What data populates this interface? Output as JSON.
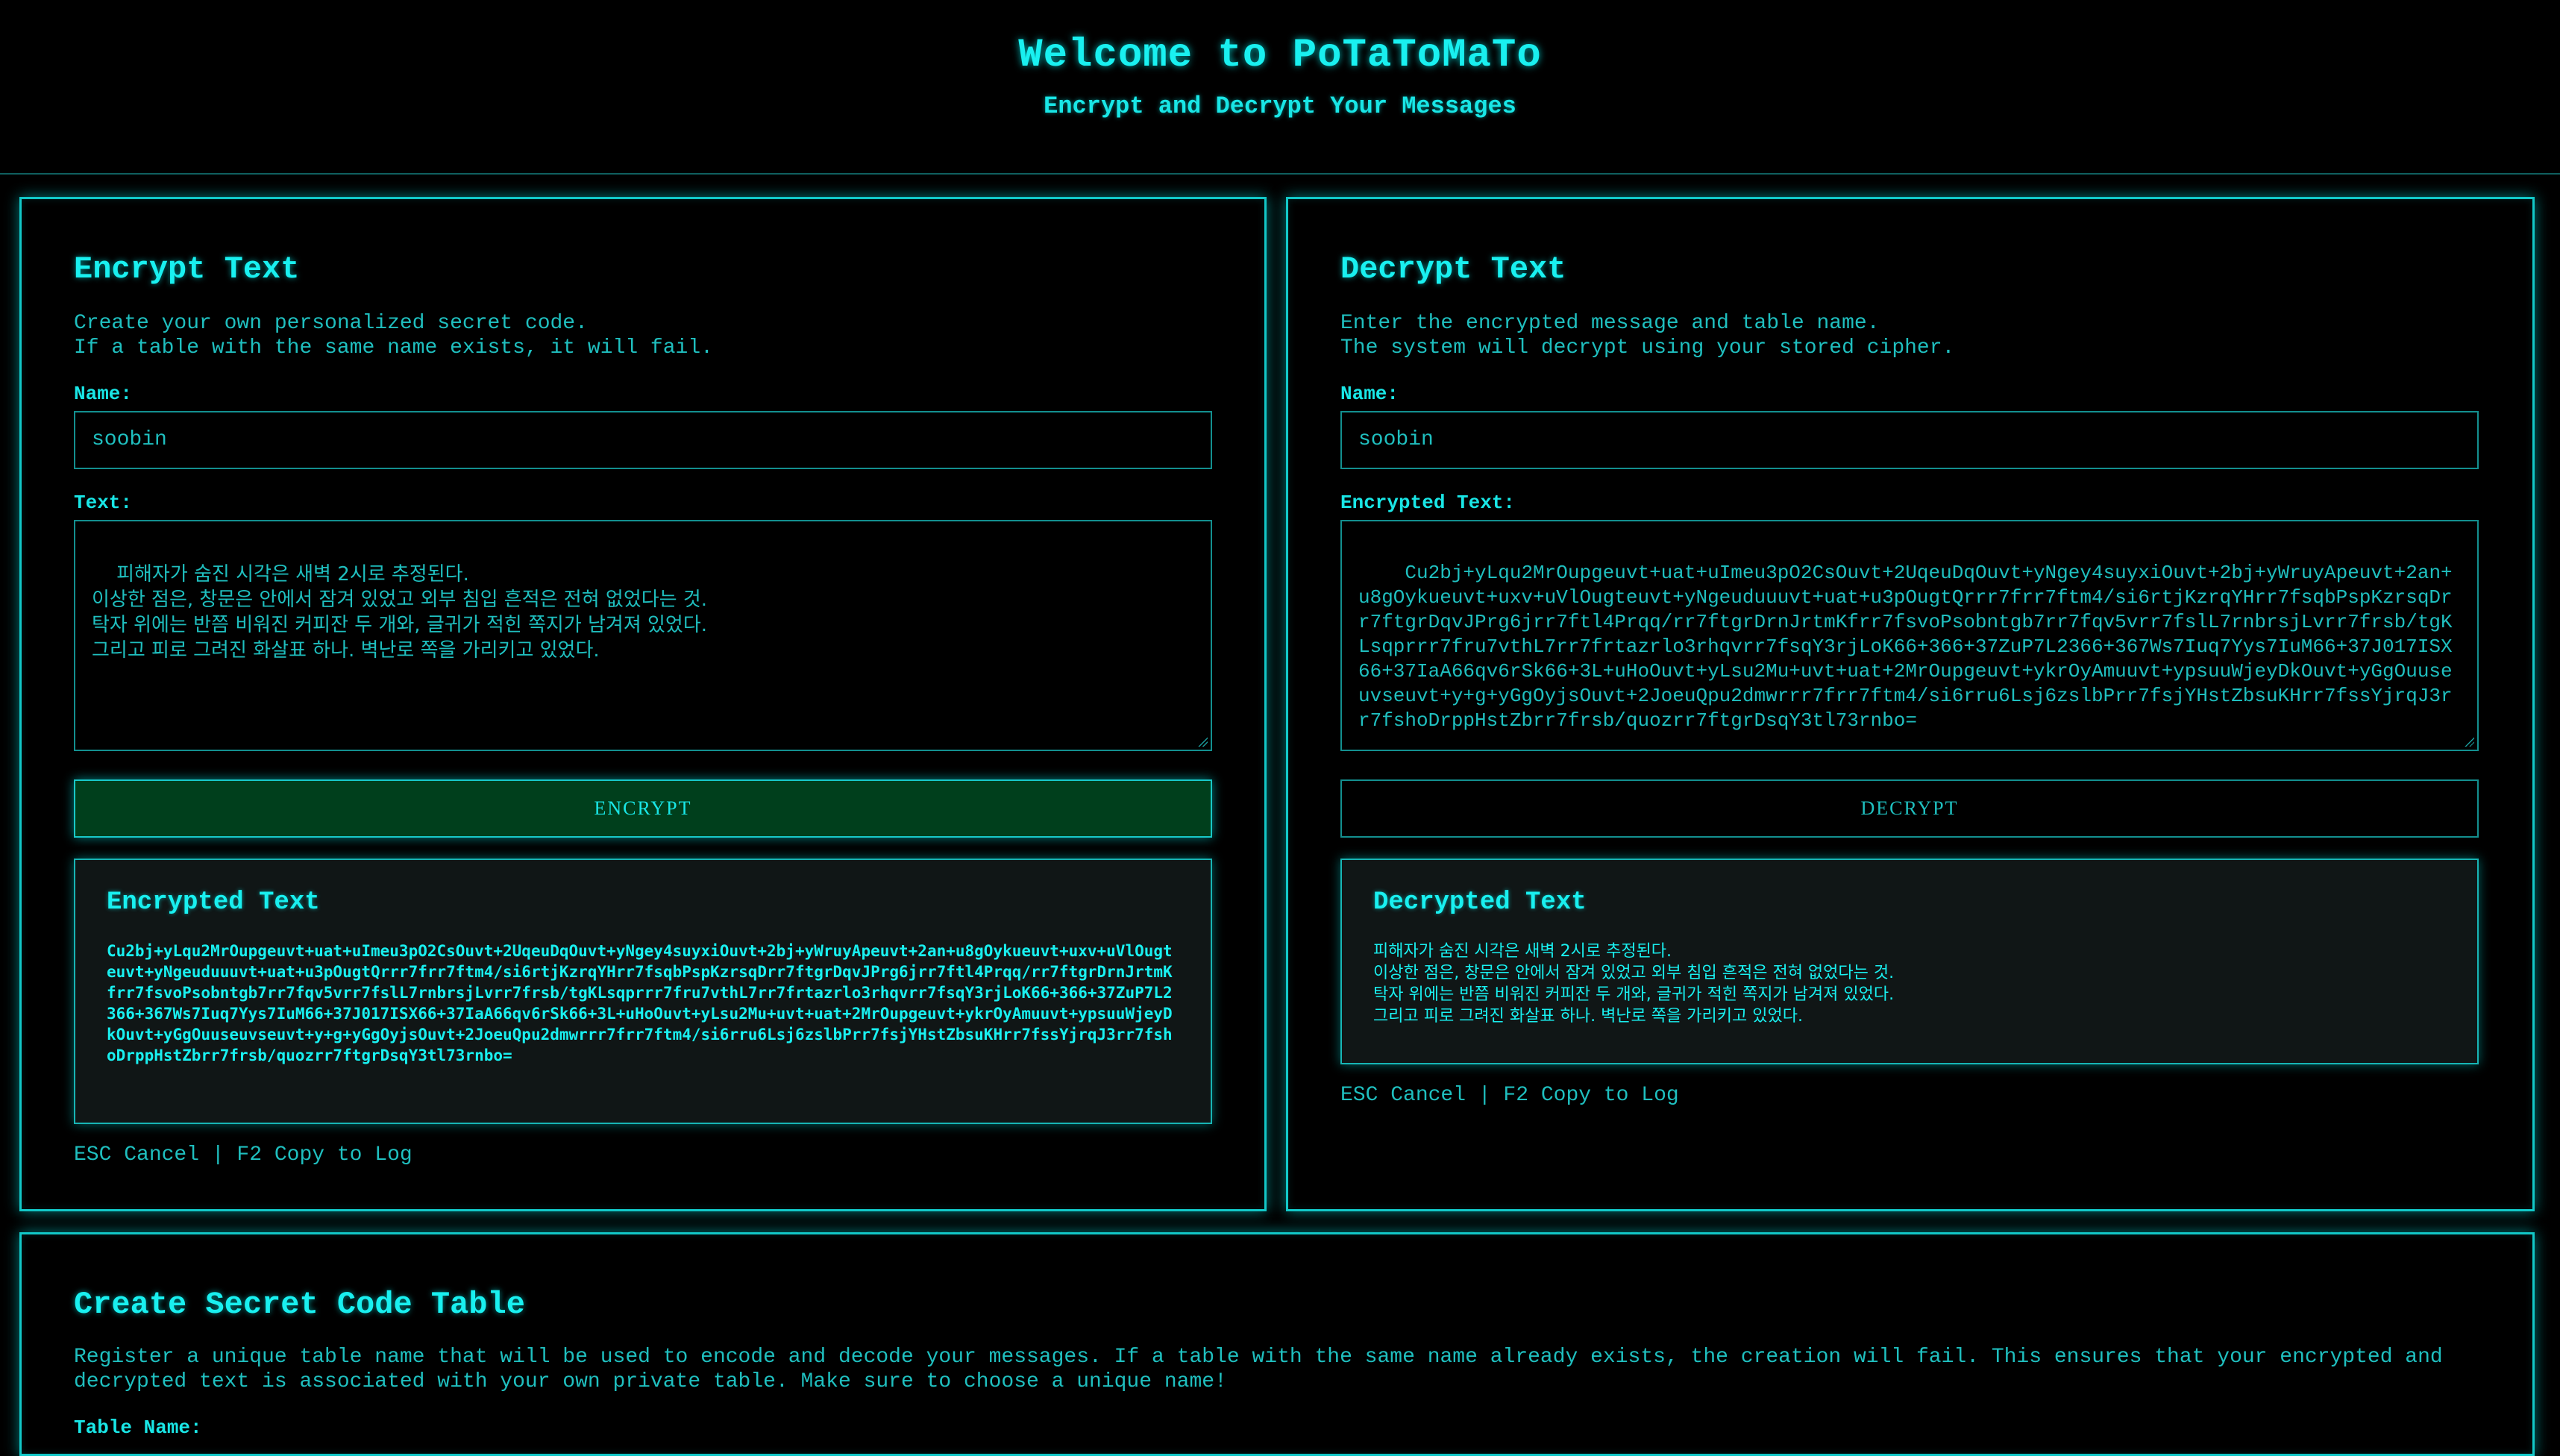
{
  "header": {
    "title": "Welcome to PoTaToMaTo",
    "subtitle": "Encrypt and Decrypt Your Messages"
  },
  "encrypt": {
    "title": "Encrypt Text",
    "description_line1": "Create your own personalized secret code.",
    "description_line2": "If a table with the same name exists, it will fail.",
    "name_label": "Name:",
    "name_value": "soobin",
    "text_label": "Text:",
    "text_value": "피해자가 숨진 시각은 새벽 2시로 추정된다.\n이상한 점은, 창문은 안에서 잠겨 있었고 외부 침입 흔적은 전혀 없었다는 것.\n탁자 위에는 반쯤 비워진 커피잔 두 개와, 글귀가 적힌 쪽지가 남겨져 있었다.\n그리고 피로 그려진 화살표 하나. 벽난로 쪽을 가리키고 있었다.",
    "button_label": "ENCRYPT",
    "result_title": "Encrypted Text",
    "result_value": "Cu2bj+yLqu2MrOupgeuvt+uat+uImeu3pO2CsOuvt+2UqeuDqOuvt+yNgey4suyxiOuvt+2bj+yWruyApeuvt+2an+u8gOykueuvt+uxv+uVlOugteuvt+yNgeuduuuvt+uat+u3pOugtQrrr7frr7ftm4/si6rtjKzrqYHrr7fsqbPspKzrsqDrr7ftgrDqvJPrg6jrr7ftl4Prqq/rr7ftgrDrnJrtmKfrr7fsvoPsobntgb7rr7fqv5vrr7fslL7rnbrsjLvrr7frsb/tgKLsqprrr7fru7vthL7rr7frtazrlo3rhqvrr7fsqY3rjLoK66+366+37ZuP7L2366+367Ws7Iuq7Yys7IuM66+37J017ISX66+37IaA66qv6rSk66+3L+uHoOuvt+yLsu2Mu+uvt+uat+2MrOupgeuvt+ykrOyAmuuvt+ypsuuWjeyDkOuvt+yGgOuuseuvseuvt+y+g+yGgOyjsOuvt+2JoeuQpu2dmwrrr7frr7ftm4/si6rru6Lsj6zslbPrr7fsjYHstZbsuKHrr7fssYjrqJ3rr7fshoDrppHstZbrr7frsb/quozrr7ftgrDsqY3tl73rnbo=",
    "hint": "ESC Cancel | F2 Copy to Log"
  },
  "decrypt": {
    "title": "Decrypt Text",
    "description_line1": "Enter the encrypted message and table name.",
    "description_line2": "The system will decrypt using your stored cipher.",
    "name_label": "Name:",
    "name_value": "soobin",
    "text_label": "Encrypted Text:",
    "text_value": "Cu2bj+yLqu2MrOupgeuvt+uat+uImeu3pO2CsOuvt+2UqeuDqOuvt+yNgey4suyxiOuvt+2bj+yWruyApeuvt+2an+u8gOykueuvt+uxv+uVlOugteuvt+yNgeuduuuvt+uat+u3pOugtQrrr7frr7ftm4/si6rtjKzrqYHrr7fsqbPspKzrsqDrr7ftgrDqvJPrg6jrr7ftl4Prqq/rr7ftgrDrnJrtmKfrr7fsvoPsobntgb7rr7fqv5vrr7fslL7rnbrsjLvrr7frsb/tgKLsqprrr7fru7vthL7rr7frtazrlo3rhqvrr7fsqY3rjLoK66+366+37ZuP7L2366+367Ws7Iuq7Yys7IuM66+37J017ISX66+37IaA66qv6rSk66+3L+uHoOuvt+yLsu2Mu+uvt+uat+2MrOupgeuvt+ykrOyAmuuvt+ypsuuWjeyDkOuvt+yGgOuuseuvseuvt+y+g+yGgOyjsOuvt+2JoeuQpu2dmwrrr7frr7ftm4/si6rru6Lsj6zslbPrr7fsjYHstZbsuKHrr7fssYjrqJ3rr7fshoDrppHstZbrr7frsb/quozrr7ftgrDsqY3tl73rnbo=",
    "button_label": "DECRYPT",
    "result_title": "Decrypted Text",
    "result_value": "피해자가 숨진 시각은 새벽 2시로 추정된다.\n이상한 점은, 창문은 안에서 잠겨 있었고 외부 침입 흔적은 전혀 없었다는 것.\n탁자 위에는 반쯤 비워진 커피잔 두 개와, 글귀가 적힌 쪽지가 남겨져 있었다.\n그리고 피로 그려진 화살표 하나. 벽난로 쪽을 가리키고 있었다.",
    "hint": "ESC Cancel | F2 Copy to Log"
  },
  "create_table": {
    "title": "Create Secret Code Table",
    "description": "Register a unique table name that will be used to encode and decode your messages. If a table with the same name already exists, the creation will fail. This ensures that your encrypted and decrypted text is associated with your own private table. Make sure to choose a unique name!",
    "table_name_label": "Table Name:"
  },
  "colors": {
    "accent": "#19f0f0",
    "text": "#1fbfbf",
    "background": "#000000",
    "encrypt_button_bg": "#003f1c"
  }
}
